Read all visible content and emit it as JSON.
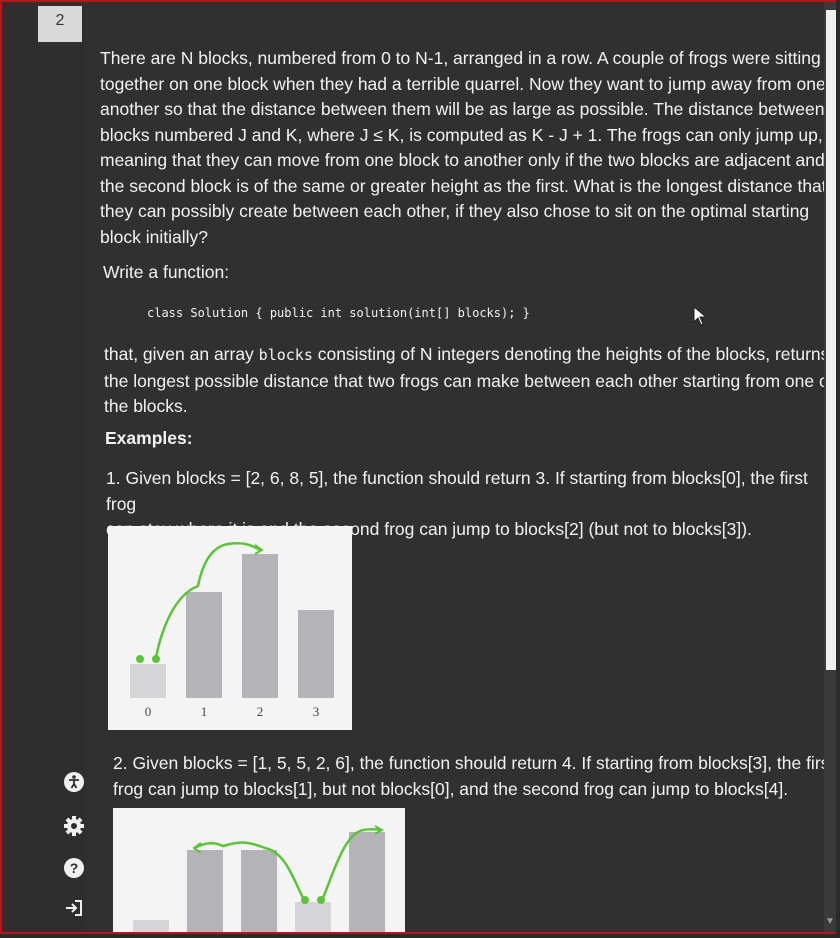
{
  "page_tab": "2",
  "statement": {
    "lines": [
      "There are N blocks, numbered from 0 to N-1, arranged in a row. A couple of frogs were sitting",
      "together on one block when they had a terrible quarrel. Now they want to jump away from one",
      "another so that the distance between them will be as large as possible. The distance between",
      "blocks numbered J and K, where J ≤ K, is computed as K - J + 1. The frogs can only jump up,",
      "meaning that they can move from one block to another only if the two blocks are adjacent and",
      "the second block is of the same or greater height as the first. What is the longest distance that",
      "they can possibly create between each other, if they also chose to sit on the optimal starting",
      "block initially?"
    ]
  },
  "write_function": "Write a function:",
  "signature": "class Solution { public int solution(int[] blocks); }",
  "returns": {
    "line1_pre": "that, given an array ",
    "line1_code": "blocks",
    "line1_post": " consisting of N integers denoting the heights of the blocks, returns",
    "line2": "the longest possible distance that two frogs can make between each other starting from one of",
    "line3": "the blocks."
  },
  "examples_heading": "Examples:",
  "example1": {
    "line1": "1. Given blocks = [2, 6, 8, 5], the function should return 3. If starting from blocks[0], the first frog",
    "line2": "can stay where it is and the second frog can jump to blocks[2] (but not to blocks[3])."
  },
  "example2": {
    "line1": "2. Given blocks = [1, 5, 5, 2, 6], the function should return 4. If starting from blocks[3], the first",
    "line2": "frog can jump to blocks[1], but not blocks[0], and the second frog can jump to blocks[4]."
  },
  "figure1": {
    "heights": [
      2,
      6,
      8,
      5
    ],
    "tick_labels": [
      "0",
      "1",
      "2",
      "3"
    ],
    "path_color": "#5cc43a"
  },
  "figure2": {
    "heights": [
      1,
      5,
      5,
      2,
      6
    ],
    "path_color": "#5cc43a"
  },
  "icons": [
    "accessibility-icon",
    "gear-icon",
    "help-icon",
    "sign-out-icon"
  ]
}
